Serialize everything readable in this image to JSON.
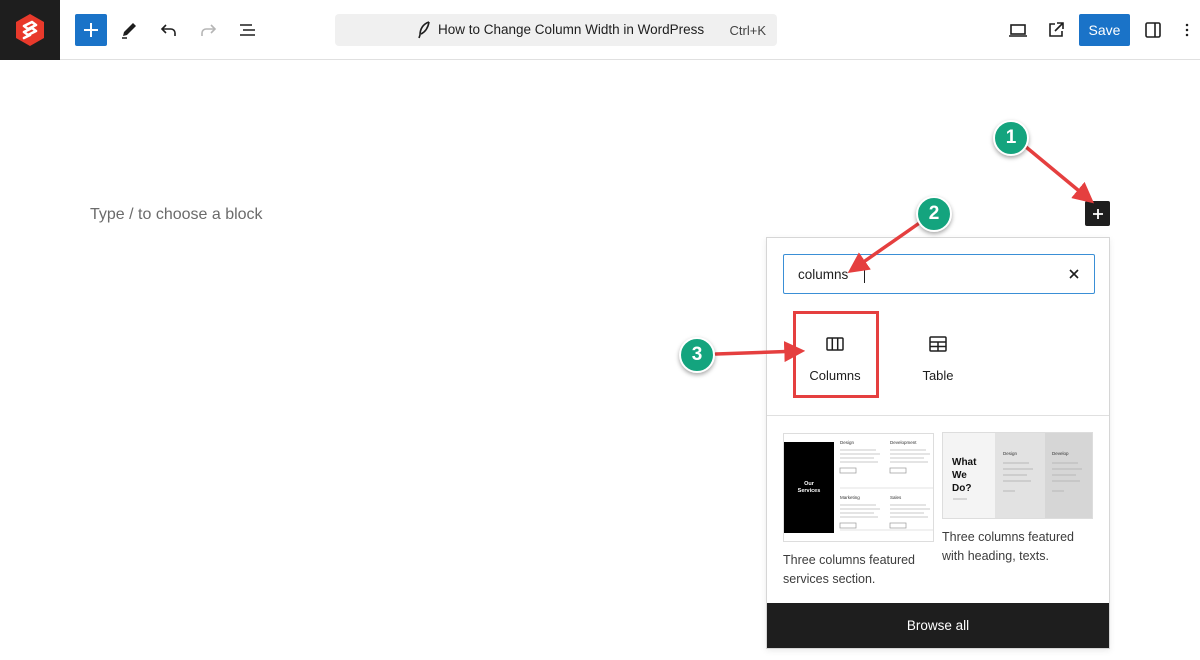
{
  "toolbar": {
    "document_title": "How to Change Column Width in WordPress",
    "command_shortcut": "Ctrl+K",
    "save_label": "Save"
  },
  "canvas": {
    "placeholder": "Type / to choose a block"
  },
  "inserter": {
    "search_value": "columns",
    "blocks": [
      {
        "label": "Columns",
        "icon": "columns-icon"
      },
      {
        "label": "Table",
        "icon": "table-icon"
      }
    ],
    "patterns": [
      {
        "description": "Three columns featured services section.",
        "thumb": {
          "heading": "Our Services",
          "cols": [
            "Design",
            "Development",
            "Marketing",
            "Sales"
          ]
        }
      },
      {
        "description": "Three columns featured with heading, texts.",
        "thumb": {
          "heading": "What We Do?",
          "cols": [
            "Design",
            "Develop"
          ]
        }
      }
    ],
    "browse_all_label": "Browse all"
  },
  "callouts": [
    "1",
    "2",
    "3"
  ],
  "colors": {
    "accent": "#1a73c8",
    "callout": "#14a47e",
    "highlight": "#e53f3f",
    "logo": "#e8392b"
  }
}
